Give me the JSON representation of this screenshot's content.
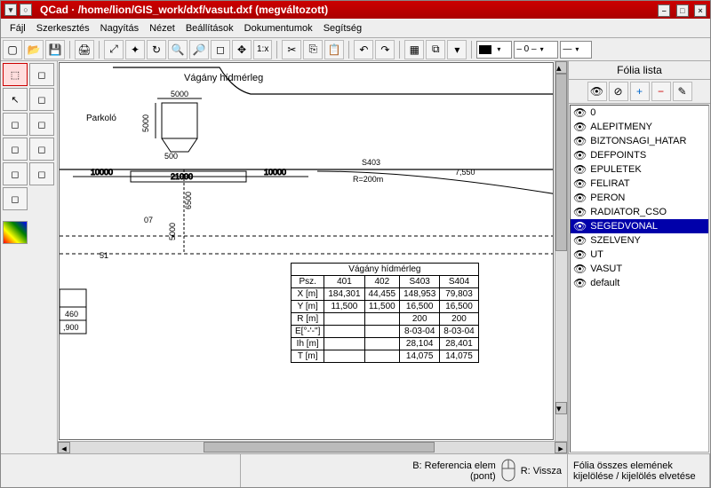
{
  "window": {
    "app": "QCad",
    "path": "/home/lion/GIS_work/dxf/vasut.dxf",
    "suffix": "(megváltozott)"
  },
  "menu": {
    "file": "Fájl",
    "edit": "Szerkesztés",
    "zoom": "Nagyítás",
    "view": "Nézet",
    "settings": "Beállítások",
    "documents": "Dokumentumok",
    "help": "Segítség"
  },
  "toolbar": {
    "zoom_ratio": "1:x",
    "combo1": "—",
    "combo2": "– 0 –",
    "combo3": "—"
  },
  "layers": {
    "title": "Fólia lista",
    "items": [
      {
        "name": "0"
      },
      {
        "name": "ALEPITMENY"
      },
      {
        "name": "BIZTONSAGI_HATAR"
      },
      {
        "name": "DEFPOINTS"
      },
      {
        "name": "EPULETEK"
      },
      {
        "name": "FELIRAT"
      },
      {
        "name": "PERON"
      },
      {
        "name": "RADIATOR_CSO"
      },
      {
        "name": "SEGEDVONAL",
        "selected": true
      },
      {
        "name": "SZELVENY"
      },
      {
        "name": "UT"
      },
      {
        "name": "VASUT"
      },
      {
        "name": "default"
      }
    ]
  },
  "drawing": {
    "label_vagany": "Vágány hídmérleg",
    "label_parkolo": "Parkoló",
    "dim_5000a": "5000",
    "dim_5000b": "5000",
    "dim_500": "500",
    "dim_10000a": "10000",
    "dim_21000": "21000",
    "dim_10000b": "10000",
    "label_s403": "S403",
    "label_r200": "R=200m",
    "dim_7550": "7,550",
    "dim_6500": "6500",
    "dim_5000c": "5000",
    "dim_07": "07",
    "dim_51": "51",
    "label_460": "460",
    "label_900": ",900"
  },
  "table": {
    "title": "Vágány hídmérleg",
    "rows": [
      "Psz.",
      "X [m]",
      "Y [m]",
      "R [m]",
      "E[°-'-\"]",
      "Ih [m]",
      "T [m]"
    ],
    "cols": [
      "401",
      "402",
      "S403",
      "S404"
    ],
    "data": {
      "X": [
        "184,301",
        "44,455",
        "148,953",
        "79,803"
      ],
      "Y": [
        "11,500",
        "11,500",
        "16,500",
        "16,500"
      ],
      "R": [
        "",
        "",
        "200",
        "200"
      ],
      "E": [
        "",
        "",
        "8-03-04",
        "8-03-04"
      ],
      "Ih": [
        "",
        "",
        "28,104",
        "28,401"
      ],
      "T": [
        "",
        "",
        "14,075",
        "14,075"
      ]
    }
  },
  "status": {
    "left_b": "B: Referencia elem",
    "left_pont": "(pont)",
    "right_r": "R: Vissza",
    "info": "Fólia összes elemének kijelölése / kijelölés elvetése"
  },
  "chart_data": {
    "type": "table",
    "title": "Vágány hídmérleg",
    "columns": [
      "Psz.",
      "401",
      "402",
      "S403",
      "S404"
    ],
    "rows": [
      [
        "X [m]",
        184.301,
        44.455,
        148.953,
        79.803
      ],
      [
        "Y [m]",
        11.5,
        11.5,
        16.5,
        16.5
      ],
      [
        "R [m]",
        null,
        null,
        200,
        200
      ],
      [
        "E[°-'-\"]",
        null,
        null,
        "8-03-04",
        "8-03-04"
      ],
      [
        "Ih [m]",
        null,
        null,
        28.104,
        28.401
      ],
      [
        "T [m]",
        null,
        null,
        14.075,
        14.075
      ]
    ]
  }
}
